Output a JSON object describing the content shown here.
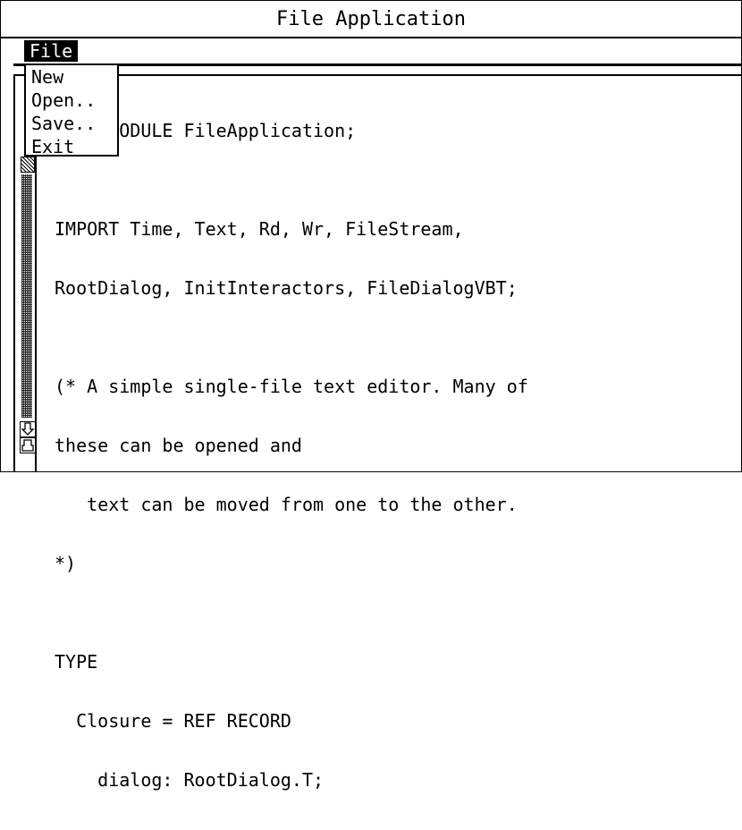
{
  "window": {
    "title": "File Application"
  },
  "menubar": {
    "file_label": "File"
  },
  "dropdown": {
    "items": [
      "New",
      "Open..",
      "Save..",
      "Exit"
    ]
  },
  "editor": {
    "lines": [
      "SAFE MODULE FileApplication;",
      "",
      "IMPORT Time, Text, Rd, Wr, FileStream,",
      "RootDialog, InitInteractors, FileDialogVBT;",
      "",
      "(* A simple single-file text editor. Many of",
      "these can be opened and",
      "   text can be moved from one to the other.",
      "*)",
      "",
      "TYPE",
      "  Closure = REF RECORD",
      "    dialog: RootDialog.T;"
    ]
  }
}
